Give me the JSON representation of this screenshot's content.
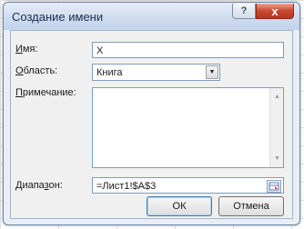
{
  "dialog": {
    "title": "Создание имени",
    "help_label": "?",
    "close_label": "x"
  },
  "form": {
    "name_label_u": "И",
    "name_label_rest": "мя:",
    "name_value": "X",
    "scope_label_u": "О",
    "scope_label_rest": "бласть:",
    "scope_value": "Книга",
    "comment_label_u": "П",
    "comment_label_rest": "римечание:",
    "comment_value": "",
    "range_label_pre": "Диапа",
    "range_label_u": "з",
    "range_label_post": "он:",
    "range_value": "=Лист1!$A$3"
  },
  "buttons": {
    "ok_label": "ОК",
    "cancel_label": "Отмена"
  }
}
